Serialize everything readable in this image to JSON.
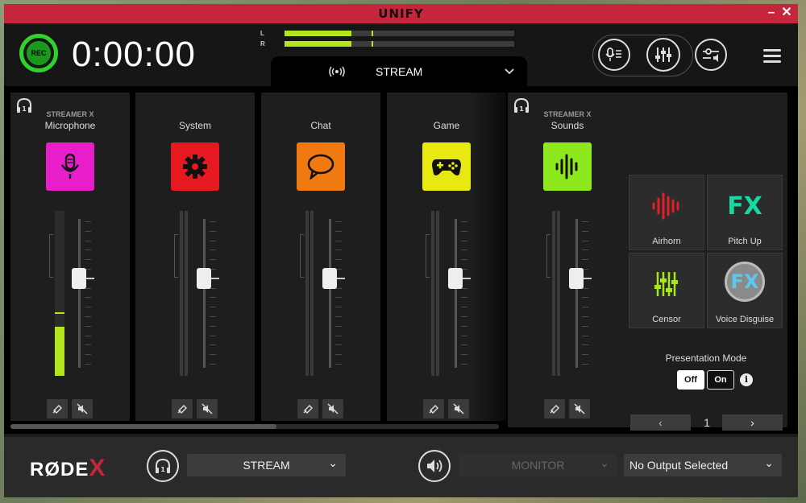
{
  "window": {
    "title": "UNIFY",
    "minimize_glyph": "–",
    "close_glyph": "✕"
  },
  "header": {
    "rec_label": "REC",
    "timer": "0:00:00",
    "meter_left_label": "L",
    "meter_right_label": "R",
    "meter_left_level": 0.29,
    "meter_right_level": 0.29,
    "mix_tab": "STREAM"
  },
  "channels": [
    {
      "id": "microphone",
      "brand": "STREAMER X",
      "name": "Microphone",
      "color": "#e81ecb",
      "icon": "microphone-icon",
      "has_headphone_badge": true,
      "level": 0.3
    },
    {
      "id": "system",
      "brand": "",
      "name": "System",
      "color": "#e5191f",
      "icon": "gear-icon",
      "has_headphone_badge": false,
      "level": 0
    },
    {
      "id": "chat",
      "brand": "",
      "name": "Chat",
      "color": "#f07a10",
      "icon": "chat-bubble-icon",
      "has_headphone_badge": false,
      "level": 0
    },
    {
      "id": "game",
      "brand": "",
      "name": "Game",
      "color": "#e8e812",
      "icon": "gamepad-icon",
      "has_headphone_badge": false,
      "level": 0
    },
    {
      "id": "sounds",
      "brand": "STREAMER X",
      "name": "Sounds",
      "color": "#8ee81e",
      "icon": "soundwave-icon",
      "has_headphone_badge": true,
      "level": 0
    }
  ],
  "sound_pads": [
    {
      "label": "Airhorn",
      "icon": "airhorn-wave-icon",
      "color": "#e0202a"
    },
    {
      "label": "Pitch Up",
      "icon": "fx-icon",
      "text": "FX",
      "color": "#17d9a2"
    },
    {
      "label": "Censor",
      "icon": "sliders-icon",
      "color": "#a7e51e"
    },
    {
      "label": "Voice Disguise",
      "icon": "fx-circle-icon",
      "text": "FX",
      "color": "#5ac8f0"
    }
  ],
  "presentation_mode": {
    "label": "Presentation Mode",
    "off": "Off",
    "on": "On",
    "selected": "Off",
    "info_glyph": "i"
  },
  "pager": {
    "page": "1",
    "prev": "‹",
    "next": "›"
  },
  "footer": {
    "logo_text": "RØDE",
    "logo_x": "X",
    "headphone_output": "STREAM",
    "monitor_output": "MONITOR",
    "output_device": "No Output Selected"
  },
  "colors": {
    "accent_red": "#c6263b",
    "meter_green": "#b4e61e",
    "rec_green": "#2fd02f"
  }
}
